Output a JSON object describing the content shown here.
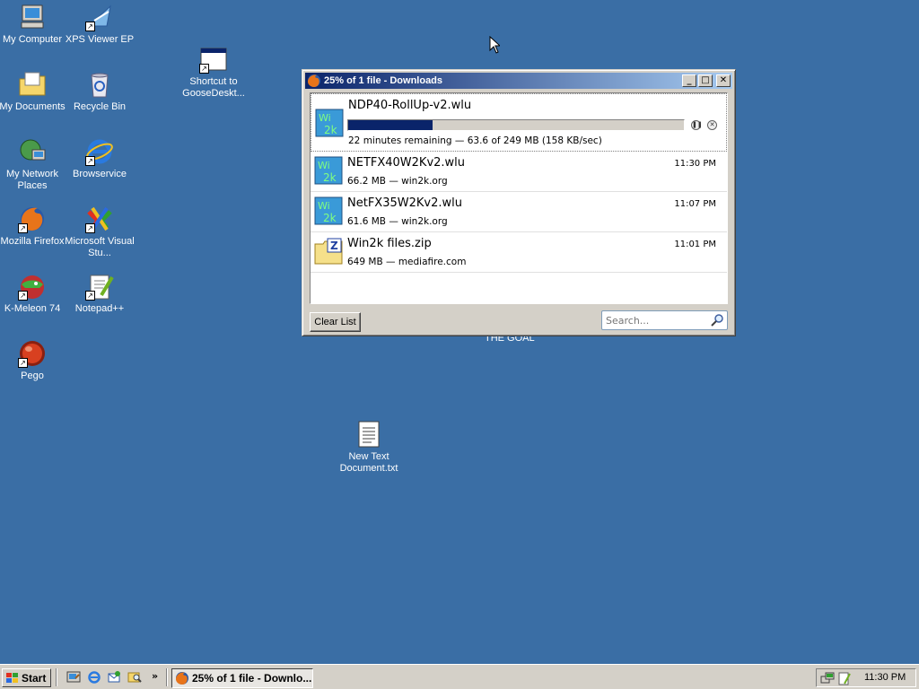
{
  "desktop": {
    "icons": [
      {
        "label": "My Computer",
        "icon": "computer-icon"
      },
      {
        "label": "XPS Viewer EP",
        "icon": "xps-viewer-icon"
      },
      {
        "label": "My Documents",
        "icon": "documents-folder-icon"
      },
      {
        "label": "Recycle Bin",
        "icon": "recycle-bin-icon"
      },
      {
        "label": "My Network Places",
        "icon": "network-icon"
      },
      {
        "label": "Browservice",
        "icon": "ie-icon"
      },
      {
        "label": "Mozilla Firefox",
        "icon": "firefox-icon"
      },
      {
        "label": "Microsoft Visual Stu...",
        "icon": "visual-studio-icon"
      },
      {
        "label": "K-Meleon 74",
        "icon": "k-meleon-icon"
      },
      {
        "label": "Notepad++",
        "icon": "notepadpp-icon"
      },
      {
        "label": "Pego",
        "icon": "pego-icon"
      },
      {
        "label": "Shortcut to GooseDeskt...",
        "icon": "window-shortcut-icon"
      },
      {
        "label": "New Text Document.txt",
        "icon": "text-file-icon"
      }
    ],
    "background_text": "THE GOAL"
  },
  "window": {
    "title": "25% of 1 file - Downloads",
    "controls": {
      "minimize": "_",
      "maximize": "□",
      "close": "✕"
    }
  },
  "downloads": {
    "active": {
      "name": "NDP40-RollUp-v2.wlu",
      "status": "22 minutes remaining — 63.6 of 249 MB (158 KB/sec)",
      "progress_percent": 25
    },
    "completed": [
      {
        "name": "NETFX40W2Kv2.wlu",
        "meta": "66.2 MB — win2k.org",
        "time": "11:30 PM",
        "icon": "win2k-file-icon"
      },
      {
        "name": "NetFX35W2Kv2.wlu",
        "meta": "61.6 MB — win2k.org",
        "time": "11:07 PM",
        "icon": "win2k-file-icon"
      },
      {
        "name": "Win2k files.zip",
        "meta": "649 MB — mediafire.com",
        "time": "11:01 PM",
        "icon": "zip-folder-icon"
      }
    ],
    "clear_list_label": "Clear List",
    "search_placeholder": "Search..."
  },
  "taskbar": {
    "start_label": "Start",
    "task_label": "25% of 1 file - Downlo...",
    "clock": "11:30 PM"
  },
  "colors": {
    "desktop": "#3a6ea5",
    "title_start": "#0a246a",
    "title_end": "#a6caf0",
    "progress": "#0a246a"
  }
}
